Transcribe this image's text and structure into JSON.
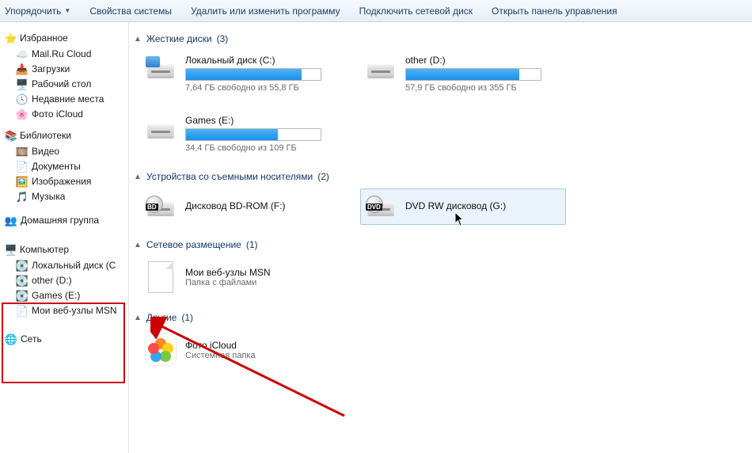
{
  "toolbar": {
    "organize": "Упорядочить",
    "props": "Свойства системы",
    "uninstall": "Удалить или изменить программу",
    "mapdrive": "Подключить сетевой диск",
    "controlpanel": "Открыть панель управления"
  },
  "nav": {
    "favorites": "Избранное",
    "fav_items": [
      "Mail.Ru Cloud",
      "Загрузки",
      "Рабочий стол",
      "Недавние места",
      "Фото iCloud"
    ],
    "libraries": "Библиотеки",
    "lib_items": [
      "Видео",
      "Документы",
      "Изображения",
      "Музыка"
    ],
    "homegroup": "Домашняя группа",
    "computer": "Компьютер",
    "comp_items": [
      "Локальный диск (C",
      "other (D:)",
      "Games (E:)",
      "Мои веб-узлы MSN"
    ],
    "network": "Сеть"
  },
  "sections": {
    "hdd": {
      "title": "Жесткие диски",
      "count": "(3)"
    },
    "removable": {
      "title": "Устройства со съемными носителями",
      "count": "(2)"
    },
    "netloc": {
      "title": "Сетевое размещение",
      "count": "(1)"
    },
    "other": {
      "title": "Другие",
      "count": "(1)"
    }
  },
  "drives": {
    "c": {
      "title": "Локальный диск (C:)",
      "sub": "7,64 ГБ свободно из 55,8 ГБ",
      "pct": 86
    },
    "d": {
      "title": "other (D:)",
      "sub": "57,9 ГБ свободно из 355 ГБ",
      "pct": 84
    },
    "e": {
      "title": "Games (E:)",
      "sub": "34,4 ГБ свободно из 109 ГБ",
      "pct": 68
    }
  },
  "removable": {
    "bd": {
      "title": "Дисковод BD-ROM (F:)",
      "tag": "BD"
    },
    "dvd": {
      "title": "DVD RW дисковод (G:)",
      "tag": "DVD"
    }
  },
  "netfolder": {
    "title": "Мои веб-узлы MSN",
    "sub": "Папка с файлами"
  },
  "otherfolder": {
    "title": "Фото iCloud",
    "sub": "Системная папка"
  }
}
